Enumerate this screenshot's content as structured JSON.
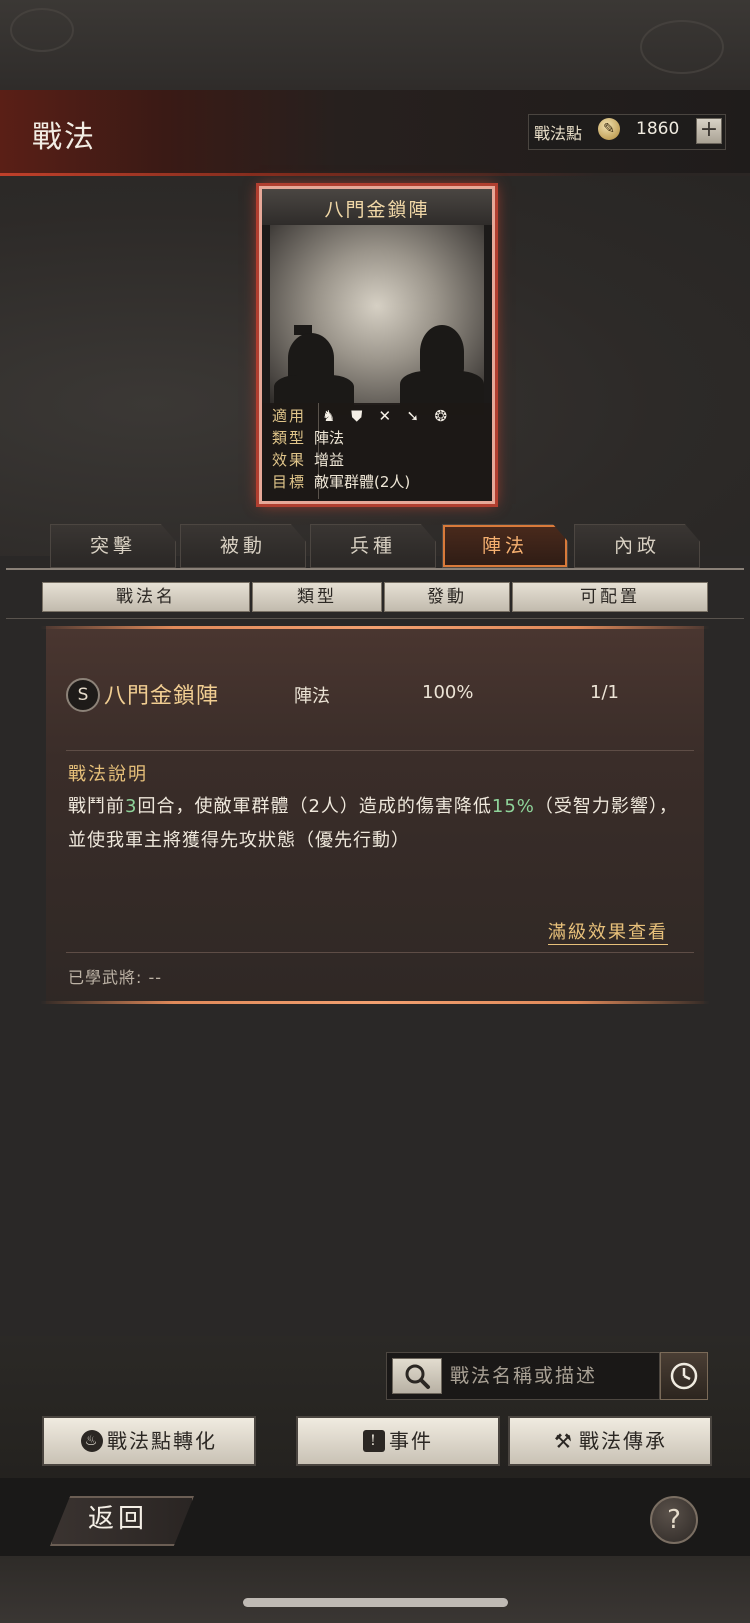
{
  "header": {
    "title": "戰法",
    "points_label": "戰法點",
    "points_value": "1860",
    "add_label": "+"
  },
  "card": {
    "title": "八門金鎖陣",
    "rows": [
      {
        "key": "適用",
        "value": ""
      },
      {
        "key": "類型",
        "value": "陣法"
      },
      {
        "key": "效果",
        "value": "增益"
      },
      {
        "key": "目標",
        "value": "敵軍群體(2人)"
      }
    ],
    "unit_icons": [
      "cavalry-icon",
      "shield-icon",
      "bow-icon",
      "spear-icon",
      "siege-icon"
    ]
  },
  "tabs": [
    {
      "label": "突擊"
    },
    {
      "label": "被動"
    },
    {
      "label": "兵種"
    },
    {
      "label": "陣法",
      "active": true
    },
    {
      "label": "內政"
    }
  ],
  "columns": [
    "戰法名",
    "類型",
    "發動",
    "可配置"
  ],
  "skill": {
    "rank": "S",
    "name": "八門金鎖陣",
    "type": "陣法",
    "rate": "100%",
    "slots": "1/1",
    "desc_title": "戰法說明",
    "desc_part1": "戰鬥前",
    "desc_hl1": "3",
    "desc_part2": "回合，使敵軍群體（2人）造成的傷害降低",
    "desc_hl2": "15%",
    "desc_part3": "（受智力影響），並使我軍主將獲得先攻狀態（優先行動）",
    "maxlevel_link": "滿級效果查看",
    "learned": "已學武將: --"
  },
  "search": {
    "placeholder": "戰法名稱或描述"
  },
  "actions": {
    "convert_label": "戰法點轉化",
    "event_label": "事件",
    "inherit_label": "戰法傳承"
  },
  "footer": {
    "back_label": "返回",
    "help_label": "?"
  },
  "colors": {
    "accent": "#d97a3a",
    "highlight": "#8fd49a",
    "gold": "#e7c07a"
  }
}
